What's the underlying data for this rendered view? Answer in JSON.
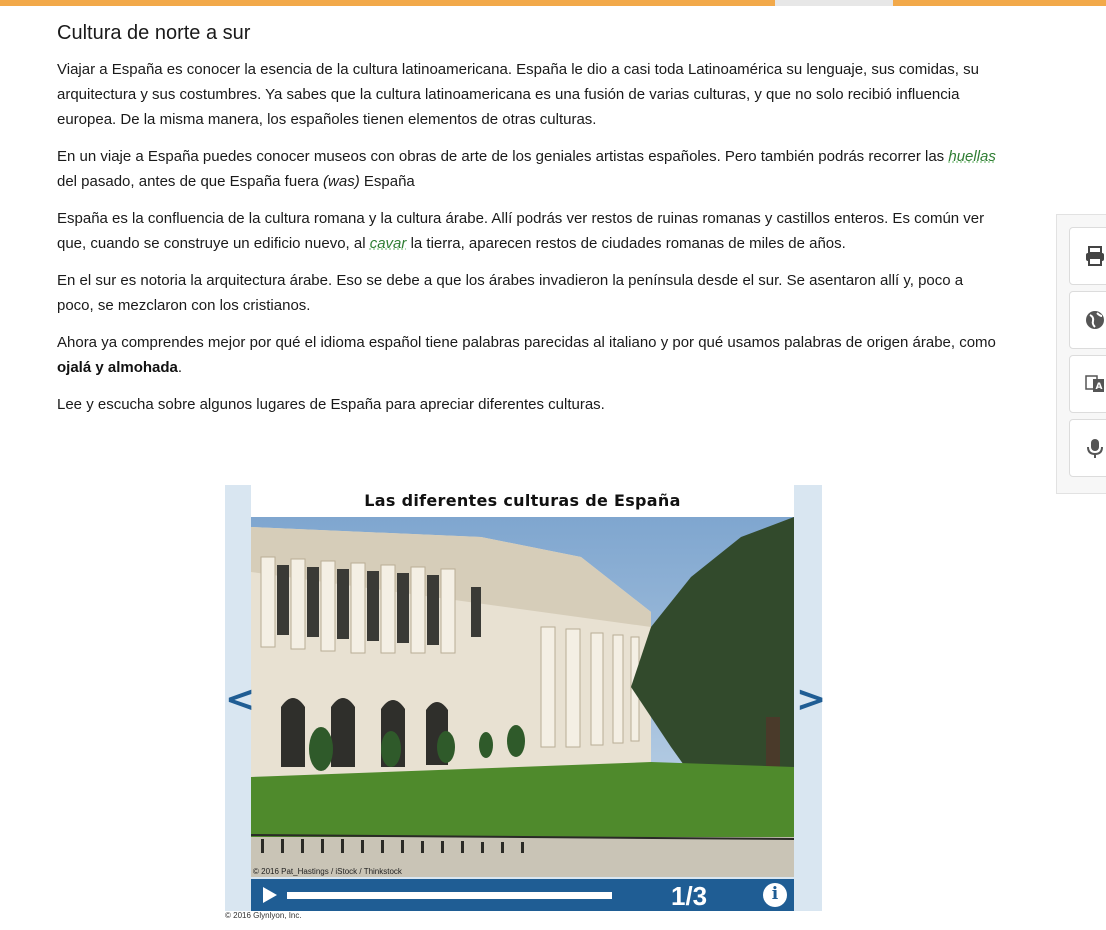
{
  "article": {
    "title": "Cultura de norte a sur",
    "p1": "Viajar a España es conocer la esencia de la cultura latinoamericana. España le dio a casi toda Latinoamérica su lenguaje, sus comidas, su arquitectura y sus costumbres. Ya sabes que la cultura latinoamericana es una fusión de varias culturas, y que no solo recibió influencia europea. De la misma manera, los españoles tienen elementos de otras culturas.",
    "p2": {
      "a": "En un viaje a España puedes conocer museos con obras de arte de los geniales artistas españoles. Pero también podrás recorrer las ",
      "gloss": "huellas",
      "b": " del pasado, antes de que España fuera ",
      "was": "(was)",
      "c": " España"
    },
    "p3": {
      "a": "España es la confluencia de la cultura romana y la cultura árabe. Allí podrás ver restos de ruinas romanas y castillos enteros. Es común ver que, cuando se construye un edificio nuevo, al ",
      "gloss": "cavar",
      "b": " la tierra, aparecen restos de ciudades romanas de miles de años."
    },
    "p4": "En el sur es notoria la arquitectura árabe. Eso se debe a que los árabes invadieron la península desde el sur. Se asentaron allí y, poco a poco, se mezclaron con los cristianos.",
    "p5": {
      "a": "Ahora ya comprendes mejor por qué el idioma español tiene palabras parecidas al italiano y por qué usamos palabras de origen árabe, como ",
      "strong": "ojalá y almohada",
      "b": "."
    },
    "p6": "Lee y escucha sobre algunos lugares de España para apreciar diferentes culturas."
  },
  "slideshow": {
    "title": "Las diferentes culturas de España",
    "photo_credit": "© 2016 Pat_Hastings / iStock / Thinkstock",
    "counter": "1/3",
    "prev": "<",
    "next": ">",
    "info": "i",
    "copyright": "© 2016 Glynlyon, Inc.",
    "progress": 1.0
  },
  "tools": [
    {
      "icon": "printer-icon"
    },
    {
      "icon": "globe-icon"
    },
    {
      "icon": "translate-icon"
    },
    {
      "icon": "microphone-icon"
    }
  ],
  "colors": {
    "accent": "#f2a94a",
    "gloss": "#2e7d32",
    "player": "#1f5d94",
    "frame": "#d9e6f1"
  }
}
